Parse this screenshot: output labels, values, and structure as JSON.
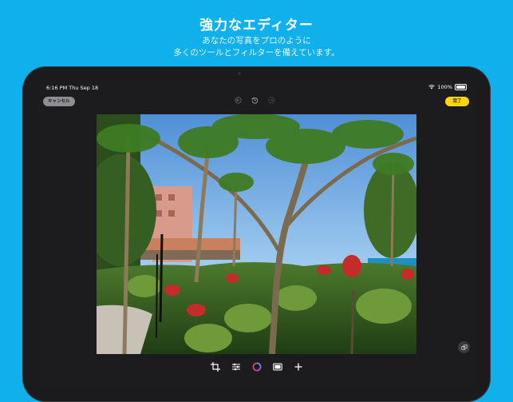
{
  "promo": {
    "title": "強力なエディター",
    "subtitle_line1": "あなたの写真をプロのように",
    "subtitle_line2": "多くのツールとフィルターを備えています。"
  },
  "status_bar": {
    "time_date": "6:16 PM  Thu Sep 18",
    "battery": "100%"
  },
  "editor": {
    "cancel_label": "キャンセル",
    "done_label": "完了",
    "top_icons": [
      "undo-icon",
      "history-icon",
      "redo-icon"
    ],
    "tools": [
      "crop-icon",
      "adjust-icon",
      "filter-icon",
      "frame-icon",
      "add-icon"
    ],
    "compare_icon": "compare-icon"
  },
  "colors": {
    "background": "#10b0ec",
    "device": "#1b1b1d",
    "done_button": "#ffd60a",
    "cancel_button": "#8e8e93"
  }
}
